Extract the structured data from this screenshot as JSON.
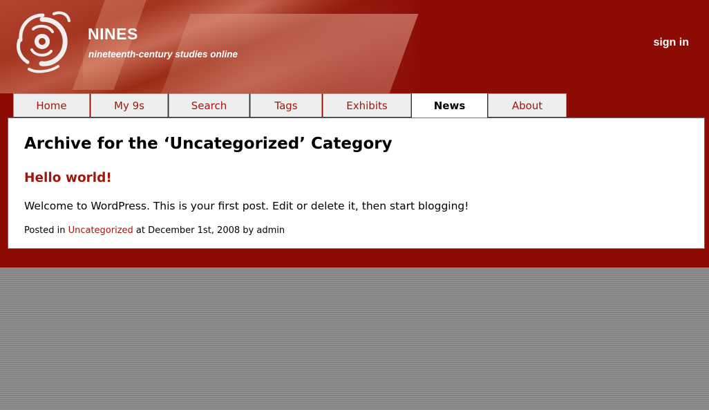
{
  "header": {
    "site_name": "NINES",
    "tagline": "nineteenth-century studies online",
    "sign_in": "sign in"
  },
  "nav": {
    "tabs": [
      {
        "label": "Home",
        "active": false
      },
      {
        "label": "My 9s",
        "active": false
      },
      {
        "label": "Search",
        "active": false
      },
      {
        "label": "Tags",
        "active": false
      },
      {
        "label": "Exhibits",
        "active": false
      },
      {
        "label": "News",
        "active": true
      },
      {
        "label": "About",
        "active": false
      }
    ]
  },
  "main": {
    "archive_heading": "Archive for the ‘Uncategorized’ Category",
    "post": {
      "title": "Hello world!",
      "body": "Welcome to WordPress. This is your first post. Edit or delete it, then start blogging!",
      "meta_prefix": "Posted in ",
      "category": "Uncategorized",
      "meta_suffix": " at December 1st, 2008 by admin"
    }
  },
  "colors": {
    "header_red": "#8c0c04",
    "link_red": "#a01808",
    "tab_background": "#eeeeee",
    "page_gray": "#8e8e8e"
  },
  "icons": {
    "logo": "nines-swirl-logo-icon"
  }
}
